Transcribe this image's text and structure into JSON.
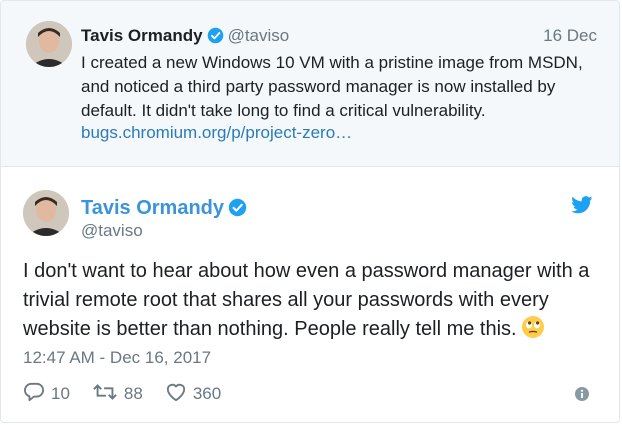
{
  "quoted": {
    "name": "Tavis Ormandy",
    "handle": "@taviso",
    "date": "16 Dec",
    "text": "I created a new Windows 10 VM with a pristine image from MSDN, and noticed a third party password manager is now installed by default. It didn't take long to find a critical vulnerability.",
    "link": "bugs.chromium.org/p/project-zero…"
  },
  "tweet": {
    "name": "Tavis Ormandy",
    "handle": "@taviso",
    "text": "I don't want to hear about how even a password manager with a trivial remote root that shares all your passwords with every website is better than nothing. People really tell me this.",
    "emoji": "face-with-rolling-eyes",
    "timestamp": "12:47 AM - Dec 16, 2017"
  },
  "actions": {
    "replies": "10",
    "retweets": "88",
    "likes": "360"
  },
  "colors": {
    "link": "#2b7bb9",
    "name_blue": "#3b94d9",
    "verified": "#1da1f2",
    "muted": "#697882",
    "quoted_bg": "#f5f8fa"
  }
}
